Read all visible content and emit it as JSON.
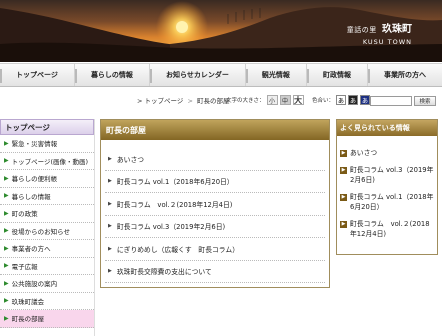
{
  "header": {
    "subtitle": "童話の里",
    "town_name": "玖珠町",
    "english_name": "KUSU TOWN"
  },
  "gnav": [
    {
      "label": "トップページ"
    },
    {
      "label": "暮らしの情報"
    },
    {
      "label": "お知らせカレンダー"
    },
    {
      "label": "観光情報"
    },
    {
      "label": "町政情報"
    },
    {
      "label": "事業所の方へ"
    }
  ],
  "breadcrumb": {
    "items": [
      "トップページ",
      "町長の部屋"
    ],
    "separator": ">"
  },
  "text_size": {
    "label": "文字の大きさ：",
    "small": "小",
    "medium": "中",
    "large": "大"
  },
  "color_scheme": {
    "label": "色合い：",
    "options": [
      "あ",
      "あ",
      "あ"
    ]
  },
  "search": {
    "button": "検索",
    "placeholder": ""
  },
  "sidebar": {
    "title": "トップページ",
    "items": [
      {
        "label": "緊急・災害情報"
      },
      {
        "label": "トップページ(画像・動画)"
      },
      {
        "label": "暮らしの便利帳"
      },
      {
        "label": "暮らしの情報"
      },
      {
        "label": "町の政策"
      },
      {
        "label": "役場からのお知らせ"
      },
      {
        "label": "事業者の方へ"
      },
      {
        "label": "電子広報"
      },
      {
        "label": "公共施設の案内"
      },
      {
        "label": "玖珠町議会"
      },
      {
        "label": "町長の部屋",
        "active": true
      }
    ]
  },
  "main": {
    "title": "町長の部屋",
    "items": [
      {
        "label": "あいさつ"
      },
      {
        "label": "町長コラム vol.1（2018年6月20日）"
      },
      {
        "label": "町長コラム　vol.２(2018年12月4日)"
      },
      {
        "label": "町長コラム vol.3（2019年2月6日)"
      },
      {
        "label": "にぎりめめし（広報くす　町長コラム）"
      },
      {
        "label": "玖珠町長交際費の支出について"
      }
    ]
  },
  "popular": {
    "title": "よく見られている情報",
    "items": [
      {
        "label": "あいさつ"
      },
      {
        "label": "町長コラム vol.3（2019年2月6日)"
      },
      {
        "label": "町長コラム vol.1（2018年6月20日）"
      },
      {
        "label": "町長コラム　vol.２(2018年12月4日)"
      }
    ]
  },
  "colors": {
    "header_gold": "#9a7a33",
    "sidebar_purple": "#dcd0ea",
    "active_pink": "#f9d6ec",
    "arrow_green": "#2d8a2d"
  }
}
